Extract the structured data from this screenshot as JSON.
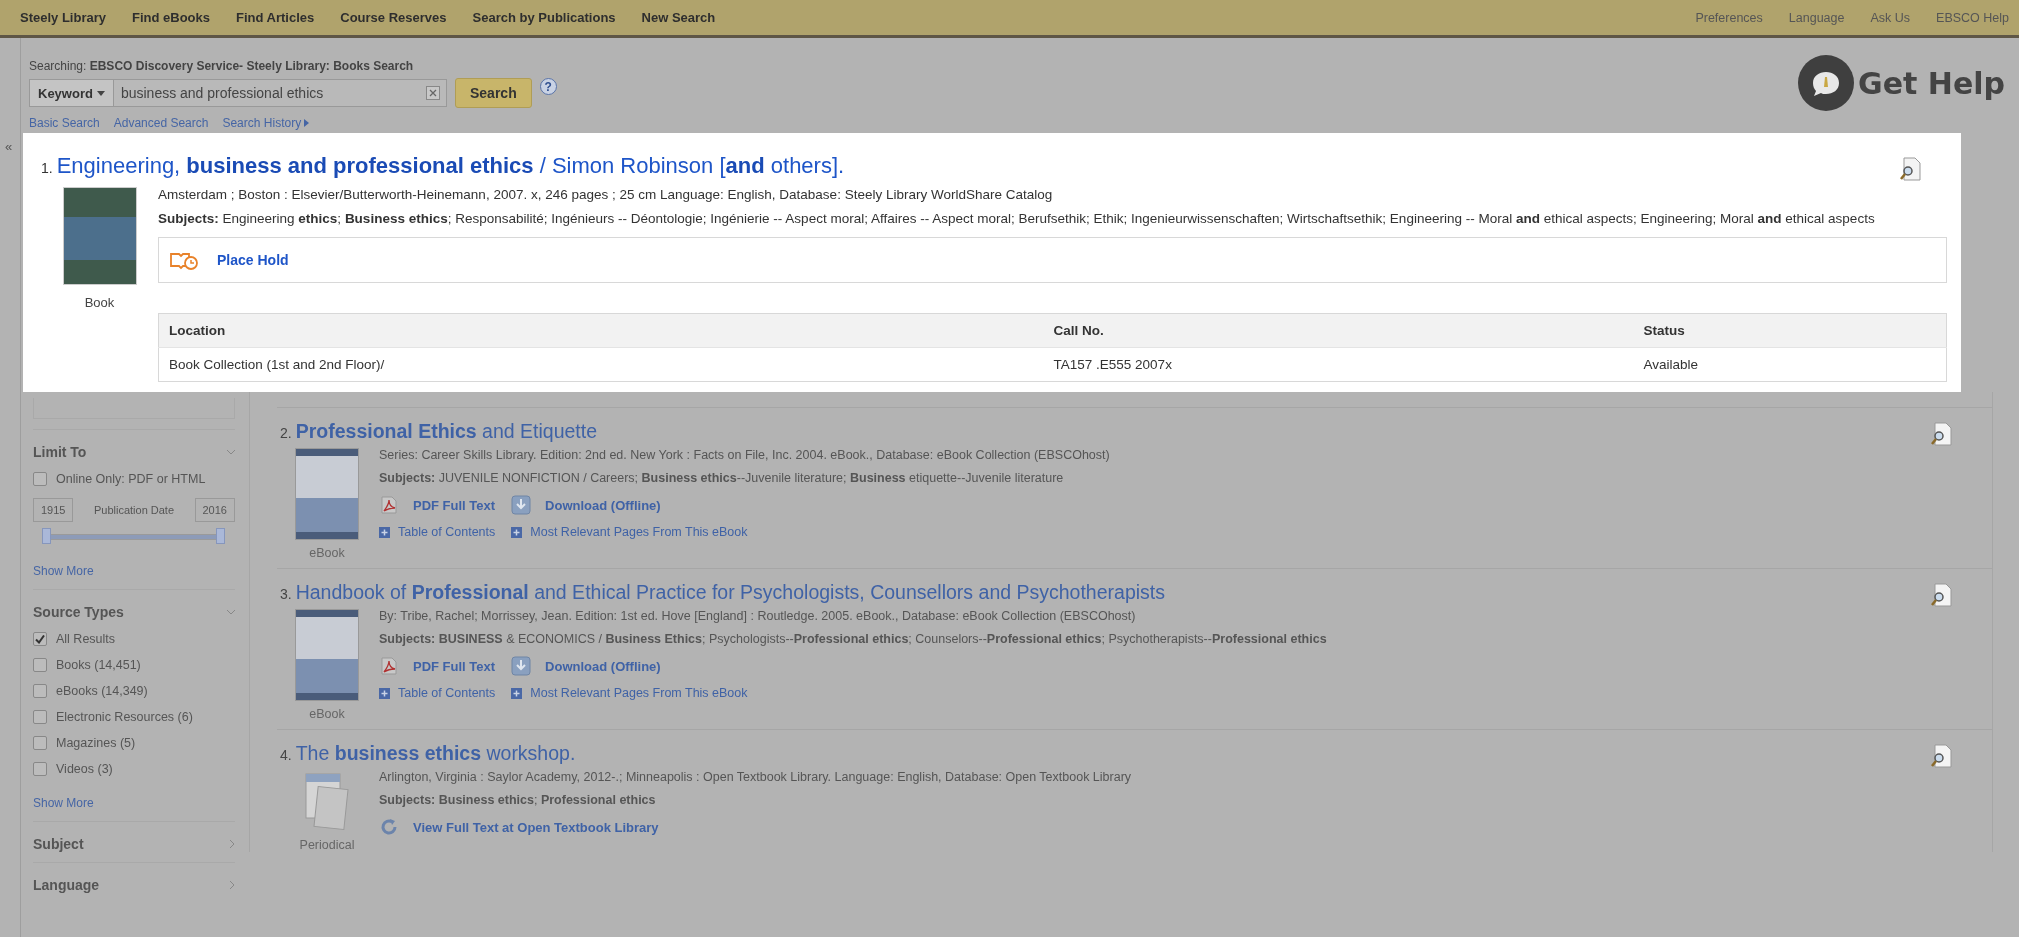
{
  "top_nav": {
    "left": [
      {
        "label": "Steely Library"
      },
      {
        "label": "Find eBooks"
      },
      {
        "label": "Find Articles"
      },
      {
        "label": "Course Reserves"
      },
      {
        "label": "Search by Publications"
      },
      {
        "label": "New Search"
      }
    ],
    "right": [
      {
        "label": "Preferences"
      },
      {
        "label": "Language"
      },
      {
        "label": "Ask Us"
      },
      {
        "label": "EBSCO Help"
      }
    ]
  },
  "search": {
    "scope": "Searching: **EBSCO Discovery Service- Steely Library: Books Search**",
    "field_type": "Keyword",
    "value": "business and professional ethics",
    "button": "Search",
    "help": "?",
    "links": [
      {
        "label": "Basic Search"
      },
      {
        "label": "Advanced Search"
      },
      {
        "label": "Search History"
      }
    ]
  },
  "get_help": {
    "label": "Get Help"
  },
  "collapse_toggle": "«",
  "highlighted_result": {
    "number": "1.",
    "title": "Engineering, **business and professional ethics** / Simon Robinson [**and** others].",
    "type": "Book",
    "meta": "Amsterdam ; Boston : Elsevier/Butterworth-Heinemann, 2007. x, 246 pages ; 25 cm Language: English, Database: Steely Library WorldShare Catalog",
    "subjects": "**Subjects:** Engineering **ethics**; **Business ethics**; Responsabilité; Ingénieurs -- Déontologie; Ingénierie -- Aspect moral; Affaires -- Aspect moral; Berufsethik; Ethik; Ingenieurwissenschaften; Wirtschaftsethik; Engineering -- Moral **and** ethical aspects; Engineering; Moral **and** ethical aspects",
    "action": "Place Hold",
    "holdings": {
      "columns": [
        "Location",
        "Call No.",
        "Status"
      ],
      "rows": [
        [
          "Book Collection (1st and 2nd Floor)/",
          "TA157 .E555 2007x",
          "Available"
        ]
      ]
    }
  },
  "sidebar": {
    "facets": [
      {
        "title": "Limit To",
        "expanded": true,
        "options": [
          {
            "label": "Online Only: PDF or HTML",
            "checked": false
          }
        ],
        "date_range": {
          "from": "1915",
          "label": "Publication Date",
          "to": "2016",
          "level": 1
        },
        "show_more": "Show More"
      },
      {
        "title": "Source Types",
        "expanded": true,
        "options": [
          {
            "label": "All Results",
            "checked": true
          },
          {
            "label": "Books (14,451)",
            "checked": false
          },
          {
            "label": "eBooks (14,349)",
            "checked": false
          },
          {
            "label": "Electronic Resources (6)",
            "checked": false
          },
          {
            "label": "Magazines (5)",
            "checked": false
          },
          {
            "label": "Videos (3)",
            "checked": false
          }
        ],
        "show_more": "Show More"
      },
      {
        "title": "Subject",
        "expanded": false
      },
      {
        "title": "Language",
        "expanded": false
      }
    ]
  },
  "results": [
    {
      "number": "2.",
      "title": "**Professional Ethics** and Etiquette",
      "type": "eBook",
      "kind": "ebook",
      "meta": "Series: Career Skills Library. Edition: 2nd ed. New York : Facts on File, Inc. 2004. eBook., Database: eBook Collection (EBSCOhost)",
      "subjects": "**Subjects:** JUVENILE NONFICTION / Careers; **Business ethics**--Juvenile literature; **Business** etiquette--Juvenile literature",
      "links": [
        {
          "kind": "pdf",
          "label": "PDF Full Text"
        },
        {
          "kind": "download",
          "label": "Download (Offline)"
        }
      ],
      "extra_links": [
        {
          "label": "Table of Contents"
        },
        {
          "label": "Most Relevant Pages From This eBook"
        }
      ]
    },
    {
      "number": "3.",
      "title": "Handbook of **Professional** and Ethical Practice for Psychologists, Counsellors and Psychotherapists",
      "type": "eBook",
      "kind": "ebook",
      "meta": "By: Tribe, Rachel; Morrissey, Jean. Edition: 1st ed. Hove [England] : Routledge. 2005. eBook., Database: eBook Collection (EBSCOhost)",
      "subjects": "**Subjects:** **BUSINESS** & ECONOMICS / **Business Ethics**; Psychologists--**Professional ethics**; Counselors--**Professional ethics**; Psychotherapists--**Professional ethics**",
      "links": [
        {
          "kind": "pdf",
          "label": "PDF Full Text"
        },
        {
          "kind": "download",
          "label": "Download (Offline)"
        }
      ],
      "extra_links": [
        {
          "label": "Table of Contents"
        },
        {
          "label": "Most Relevant Pages From This eBook"
        }
      ]
    },
    {
      "number": "4.",
      "title": "The **business ethics** workshop.",
      "type": "Periodical",
      "kind": "periodical",
      "meta": "Arlington, Virginia : Saylor Academy, 2012-.; Minneapolis : Open Textbook Library. Language: English, Database: Open Textbook Library",
      "subjects": "**Subjects:** **Business ethics**; **Professional ethics**",
      "links": [
        {
          "kind": "external",
          "label": "View Full Text at Open Textbook Library"
        }
      ]
    }
  ]
}
